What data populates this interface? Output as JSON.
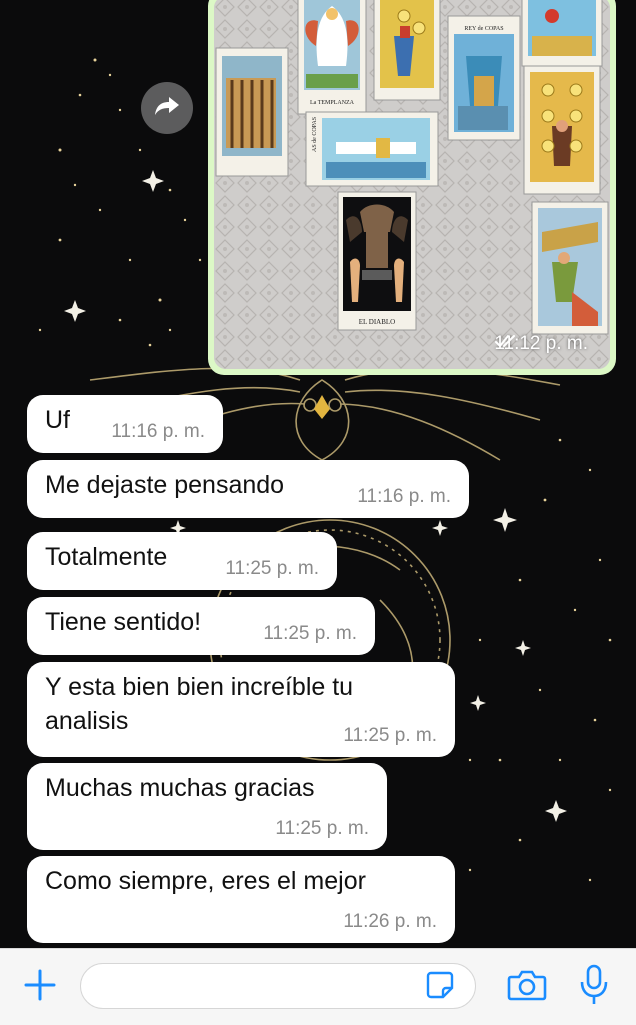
{
  "image_message": {
    "time": "11:12 p. m.",
    "status_icon": "double-check-icon",
    "cards": [
      "La TEMPLANZA",
      "REY de COPAS",
      "AS de COPAS",
      "EL DIABLO"
    ]
  },
  "forward_icon": "forward-arrow-icon",
  "messages": [
    {
      "text": "Uf",
      "time": "11:16 p. m."
    },
    {
      "text": "Me dejaste pensando",
      "time": "11:16 p. m."
    },
    {
      "text": "Totalmente",
      "time": "11:25 p. m."
    },
    {
      "text": "Tiene sentido!",
      "time": "11:25 p. m."
    },
    {
      "text": "Y esta bien bien increíble tu analisis",
      "time": "11:25 p. m."
    },
    {
      "text": "Muchas muchas gracias",
      "time": "11:25 p. m."
    },
    {
      "text": "Como siempre, eres el mejor",
      "time": "11:26 p. m."
    }
  ],
  "input_bar": {
    "attach_icon": "plus-icon",
    "sticker_icon": "sticker-icon",
    "camera_icon": "camera-icon",
    "mic_icon": "microphone-icon",
    "placeholder": ""
  },
  "colors": {
    "outgoing_bubble": "#dcf8c6",
    "incoming_bubble": "#ffffff",
    "accent": "#1a8cff",
    "wallpaper": "#0b0b0c"
  }
}
